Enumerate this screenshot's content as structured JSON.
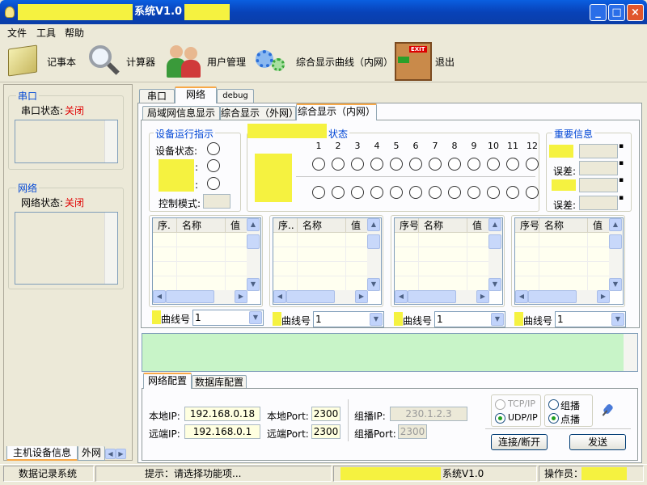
{
  "window": {
    "title_suffix": "系统V1.0"
  },
  "menu": [
    "文件",
    "工具",
    "帮助"
  ],
  "toolbar": {
    "notepad": "记事本",
    "calculator": "计算器",
    "user_mgmt": "用户管理",
    "curve": "综合显示曲线（内网）",
    "exit": "退出",
    "exit_sign": "EXIT"
  },
  "left": {
    "serial_title": "串口",
    "serial_status_label": "串口状态:",
    "serial_status_value": "关闭",
    "net_title": "网络",
    "net_status_label": "网络状态:",
    "net_status_value": "关闭",
    "tab1": "主机设备信息",
    "tab2": "外网"
  },
  "tabs_top": [
    "串口",
    "网络",
    "debug"
  ],
  "tabs_sub": [
    "局域网信息显示",
    "综合显示（外网）",
    "综合显示（内网）"
  ],
  "device": {
    "title": "设备运行指示",
    "status_label": "设备状态:",
    "control_label": "控制模式:"
  },
  "status_group": {
    "suffix": "状态",
    "numbers": [
      "1",
      "2",
      "3",
      "4",
      "5",
      "6",
      "7",
      "8",
      "9",
      "10",
      "11",
      "12"
    ]
  },
  "important": {
    "title": "重要信息",
    "error_label": "误差:"
  },
  "grids": [
    {
      "h1": "序.",
      "h2": "名称",
      "h3": "值"
    },
    {
      "h1": "序..",
      "h2": "名称",
      "h3": "值"
    },
    {
      "h1": "序号",
      "h2": "名称",
      "h3": "值"
    },
    {
      "h1": "序号",
      "h2": "名称",
      "h3": "值"
    }
  ],
  "curve_label": "曲线号",
  "curve_value": "1",
  "config_tabs": [
    "网络配置",
    "数据库配置"
  ],
  "net": {
    "local_ip_label": "本地IP:",
    "local_ip": "192.168.0.18",
    "remote_ip_label": "远端IP:",
    "remote_ip": "192.168.0.1",
    "local_port_label": "本地Port:",
    "local_port": "2300",
    "remote_port_label": "远端Port:",
    "remote_port": "2300",
    "mc_ip_label": "组播IP:",
    "mc_ip": "230.1.2.3",
    "mc_port_label": "组播Port:",
    "mc_port": "2300",
    "tcp": "TCP/IP",
    "udp": "UDP/IP",
    "multicast": "组播",
    "unicast": "点播",
    "connect": "连接/断开",
    "send": "发送"
  },
  "statusbar": {
    "left": "数据记录系统",
    "hint": "提示：请选择功能项...",
    "sys": "系统V1.0",
    "operator": "操作员："
  }
}
